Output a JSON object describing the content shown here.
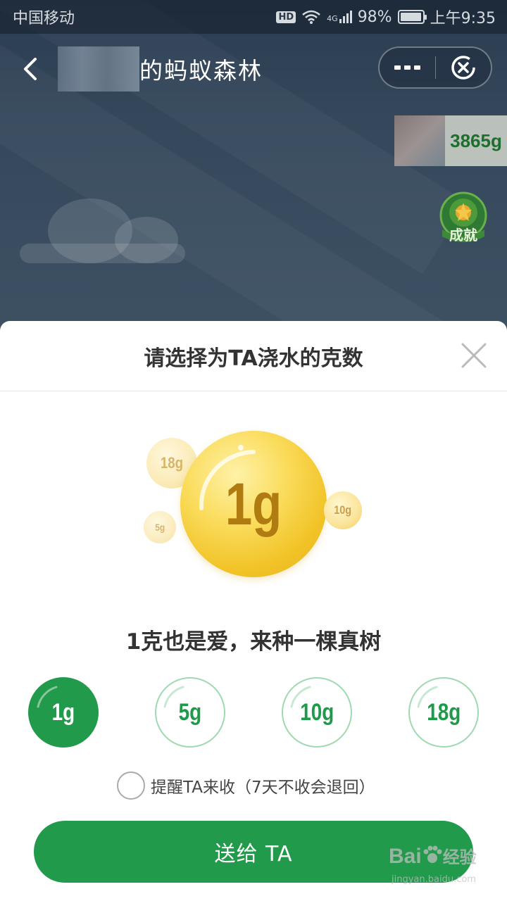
{
  "status_bar": {
    "carrier": "中国移动",
    "hd": "HD",
    "network": "4G",
    "battery": "98%",
    "battery_level": 0.98,
    "time": "上午9:35"
  },
  "header": {
    "title": "的蚂蚁森林"
  },
  "energy": {
    "value": "3865g"
  },
  "achievement": {
    "label": "成就"
  },
  "sheet": {
    "title": "请选择为TA浇水的克数",
    "big_drop": "1g",
    "small_drops": [
      "18g",
      "10g",
      "5g"
    ],
    "slogan": "1克也是爱，来种一棵真树",
    "options": [
      {
        "label": "1g",
        "selected": true
      },
      {
        "label": "5g",
        "selected": false
      },
      {
        "label": "10g",
        "selected": false
      },
      {
        "label": "18g",
        "selected": false
      }
    ],
    "remind_label": "提醒TA来收（7天不收会退回）",
    "remind_checked": false,
    "send_label": "送给 TA"
  },
  "watermark": {
    "brand": "Bai",
    "brand_cn": "经验",
    "url": "jingyan.baidu.com"
  },
  "colors": {
    "accent_green": "#229a4c",
    "drop_gold": "#f1c327"
  }
}
